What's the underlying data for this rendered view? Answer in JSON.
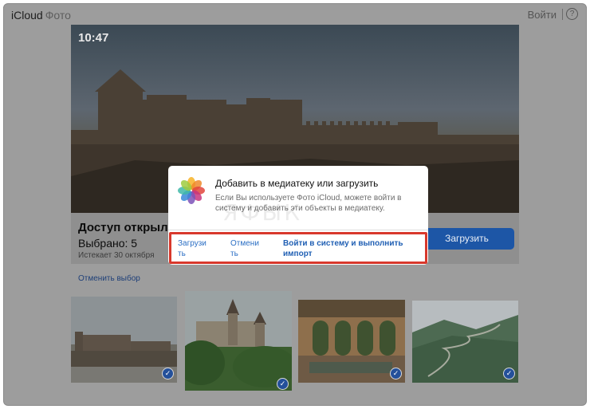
{
  "header": {
    "brand": "iCloud",
    "brand_sub": "Фото",
    "signin_label": "Войти",
    "help_label": "?"
  },
  "hero": {
    "time": "10:47"
  },
  "panel": {
    "title": "Доступ открыл(а",
    "selected": "Выбрано: 5",
    "expires": "Истекает 30 октября",
    "upload_label": "Загрузить"
  },
  "deselect_label": "Отменить выбор",
  "dialog": {
    "title": "Добавить в медиатеку или загрузить",
    "text": "Если Вы используете Фото iCloud, можете войти в систему и добавить эти объекты в медиатеку.",
    "watermark": "ЯФЫК",
    "actions": {
      "upload_line1": "Загрузи",
      "upload_line2": "ть",
      "cancel_line1": "Отмени",
      "cancel_line2": "ть",
      "signin_line1": "Войти в систему и выполнить",
      "signin_line2": "импорт"
    }
  },
  "thumbnails": [
    {
      "name": "fortress",
      "selected": true
    },
    {
      "name": "castle",
      "selected": true
    },
    {
      "name": "arches",
      "selected": true
    },
    {
      "name": "mountain-road",
      "selected": true
    }
  ],
  "colors": {
    "accent": "#1d56a6",
    "highlight": "#d8382c",
    "link": "#2a6ec4"
  }
}
